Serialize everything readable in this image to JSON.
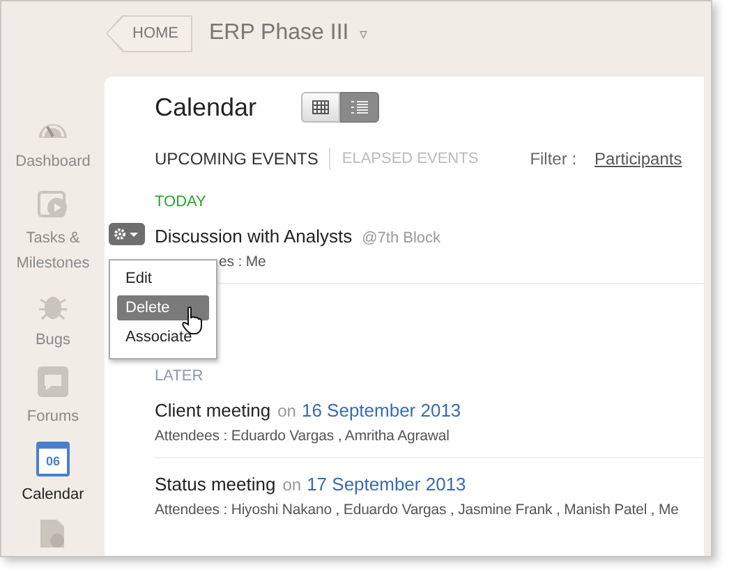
{
  "breadcrumb": {
    "home": "HOME",
    "project": "ERP Phase III",
    "caret": "▿"
  },
  "sidebar": {
    "items": [
      {
        "kind": "dashboard",
        "label": "Dashboard",
        "selected": false
      },
      {
        "kind": "tasks",
        "label": "Tasks &\nMilestones",
        "selected": false
      },
      {
        "kind": "bugs",
        "label": "Bugs",
        "selected": false
      },
      {
        "kind": "forums",
        "label": "Forums",
        "selected": false
      },
      {
        "kind": "calendar",
        "label": "Calendar",
        "icon_text": "06",
        "selected": true
      },
      {
        "kind": "timesheet",
        "selected": false
      }
    ]
  },
  "calendar": {
    "title": "Calendar",
    "views": [
      {
        "kind": "grid",
        "selected": false
      },
      {
        "kind": "list",
        "selected": true
      }
    ],
    "tabs": [
      {
        "label": "UPCOMING EVENTS",
        "selected": true
      },
      {
        "label": "ELAPSED EVENTS",
        "selected": false
      }
    ],
    "filter": {
      "label": "Filter :",
      "link": "Participants"
    },
    "sections": [
      {
        "label": "TODAY",
        "color": "#2aa52a",
        "events": [
          {
            "title": "Discussion with Analysts",
            "place": "@7th Block",
            "attendees": "es : Me",
            "menu": true
          }
        ]
      },
      {
        "label": "LATER",
        "color": "#8a9bb0",
        "events": [
          {
            "title": "Client meeting",
            "on": "on",
            "date": "16 September 2013",
            "attendees": "Attendees : Eduardo Vargas , Amritha Agrawal"
          },
          {
            "title": "Status meeting",
            "on": "on",
            "date": "17 September 2013",
            "attendees": "Attendees : Hiyoshi Nakano , Eduardo Vargas , Jasmine Frank , Manish Patel , Me"
          }
        ]
      }
    ]
  },
  "action_menu": {
    "items": [
      {
        "label": "Edit",
        "selected": false
      },
      {
        "label": "Delete",
        "selected": true
      },
      {
        "label": "Associate",
        "selected": false
      }
    ]
  }
}
